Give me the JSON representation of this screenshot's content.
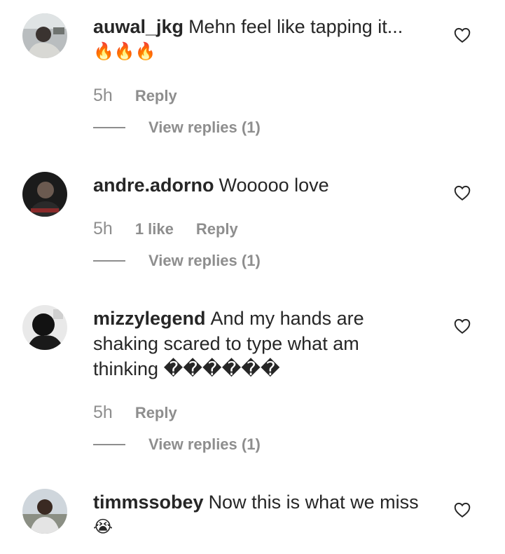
{
  "comments": [
    {
      "username": "auwal_jkg",
      "text": "Mehn feel like tapping it...",
      "emoji": "🔥🔥🔥",
      "time": "5h",
      "reply_label": "Reply",
      "view_replies": "View replies (1)"
    },
    {
      "username": "andre.adorno",
      "text": "Wooooo love",
      "time": "5h",
      "likes": "1 like",
      "reply_label": "Reply",
      "view_replies": "View replies (1)"
    },
    {
      "username": "mizzylegend",
      "text": "And my hands are shaking scared to type what am thinking ������",
      "time": "5h",
      "reply_label": "Reply",
      "view_replies": "View replies (1)"
    },
    {
      "username": "timmssobey",
      "text": "Now this is what we miss",
      "emoji": "😭",
      "time": "",
      "reply_label": ""
    }
  ],
  "icons": {
    "like": "heart-outline-icon",
    "fire": "fire-emoji",
    "crying": "crying-face-emoji"
  },
  "colors": {
    "text": "#262626",
    "muted": "#8e8e8e",
    "background": "#ffffff"
  }
}
